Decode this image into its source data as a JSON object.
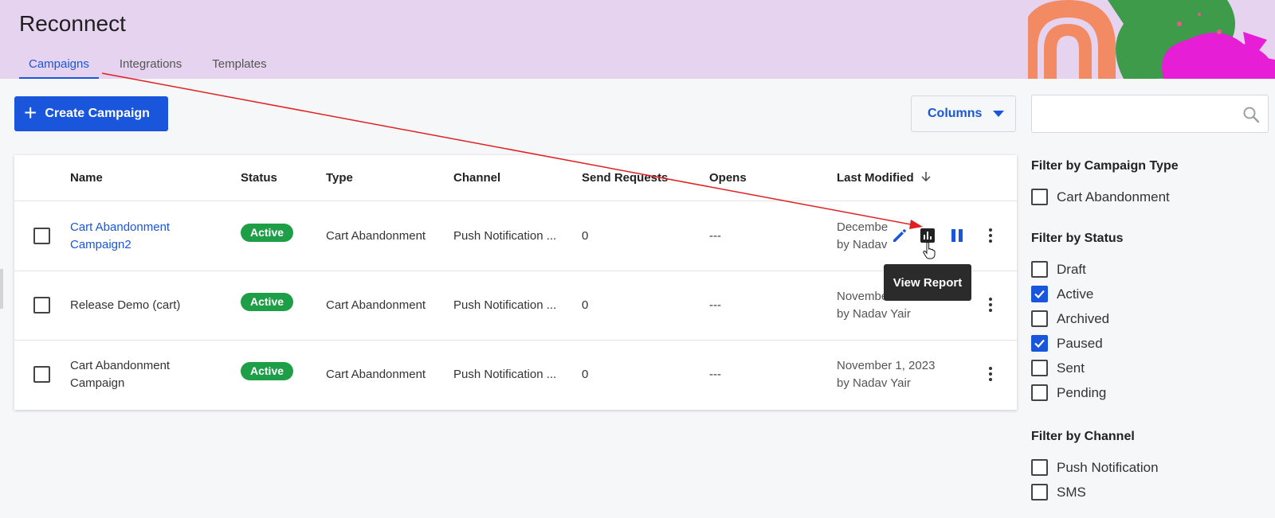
{
  "app": {
    "title": "Reconnect"
  },
  "tabs": [
    {
      "label": "Campaigns",
      "active": true
    },
    {
      "label": "Integrations",
      "active": false
    },
    {
      "label": "Templates",
      "active": false
    }
  ],
  "toolbar": {
    "create_label": "Create Campaign",
    "columns_label": "Columns",
    "search_placeholder": ""
  },
  "table": {
    "columns": [
      "Name",
      "Status",
      "Type",
      "Channel",
      "Send Requests",
      "Opens",
      "Last Modified"
    ],
    "sort_column": "Last Modified",
    "rows": [
      {
        "name_line1": "Cart Abandonment",
        "name_line2": "Campaign2",
        "status": "Active",
        "type": "Cart Abandonment",
        "channel": "Push Notification ...",
        "send_requests": "0",
        "opens": "---",
        "modified_line1": "Decembe",
        "modified_line2": "by Nadav"
      },
      {
        "name_line1": "Release Demo (cart)",
        "name_line2": "",
        "status": "Active",
        "type": "Cart Abandonment",
        "channel": "Push Notification ...",
        "send_requests": "0",
        "opens": "---",
        "modified_line1": "Novembe",
        "modified_line2": "by Nadav Yair"
      },
      {
        "name_line1": "Cart Abandonment",
        "name_line2": "Campaign",
        "status": "Active",
        "type": "Cart Abandonment",
        "channel": "Push Notification ...",
        "send_requests": "0",
        "opens": "---",
        "modified_line1": "November 1, 2023",
        "modified_line2": "by Nadav Yair"
      }
    ]
  },
  "tooltip": {
    "text": "View Report"
  },
  "filters": {
    "campaign_type": {
      "title": "Filter by Campaign Type",
      "options": [
        {
          "label": "Cart Abandonment",
          "checked": false
        }
      ]
    },
    "status": {
      "title": "Filter by Status",
      "options": [
        {
          "label": "Draft",
          "checked": false
        },
        {
          "label": "Active",
          "checked": true
        },
        {
          "label": "Archived",
          "checked": false
        },
        {
          "label": "Paused",
          "checked": true
        },
        {
          "label": "Sent",
          "checked": false
        },
        {
          "label": "Pending",
          "checked": false
        }
      ]
    },
    "channel": {
      "title": "Filter by Channel",
      "options": [
        {
          "label": "Push Notification",
          "checked": false
        },
        {
          "label": "SMS",
          "checked": false
        }
      ]
    }
  },
  "colors": {
    "accent": "#1a56db",
    "header_bg": "#e6d3f0",
    "active_badge": "#1e9e46",
    "annotation_arrow": "#e02020"
  },
  "icons": {
    "edit": "pencil-icon",
    "report": "bar-chart-icon",
    "pause": "pause-icon",
    "more": "kebab-icon",
    "search": "search-icon",
    "sort": "arrow-down-icon"
  }
}
